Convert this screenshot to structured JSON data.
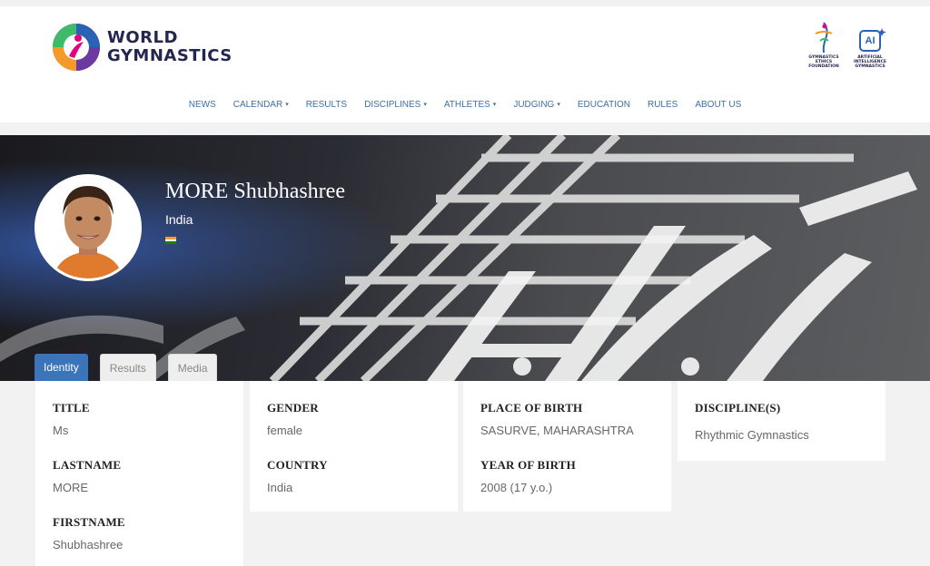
{
  "header": {
    "logo_line1": "WORLD",
    "logo_line2": "GYMNASTICS",
    "partners": [
      {
        "label": "GYMNASTICS\nETHICS\nFOUNDATION",
        "icon": "ethics-foundation-logo"
      },
      {
        "badge": "AI",
        "label": "ARTIFICIAL\nINTELLIGENCE\nGYMNASTICS",
        "icon": "ai-gymnastics-logo"
      }
    ]
  },
  "nav": {
    "items": [
      {
        "label": "NEWS",
        "has_caret": false
      },
      {
        "label": "CALENDAR",
        "has_caret": true
      },
      {
        "label": "RESULTS",
        "has_caret": false
      },
      {
        "label": "DISCIPLINES",
        "has_caret": true
      },
      {
        "label": "ATHLETES",
        "has_caret": true
      },
      {
        "label": "JUDGING",
        "has_caret": true
      },
      {
        "label": "EDUCATION",
        "has_caret": false
      },
      {
        "label": "RULES",
        "has_caret": false
      },
      {
        "label": "ABOUT US",
        "has_caret": false
      }
    ],
    "caret": "▾"
  },
  "athlete": {
    "name": "MORE Shubhashree",
    "country": "India",
    "flag_colors": [
      "#ff9933",
      "#ffffff",
      "#138808"
    ]
  },
  "tabs": [
    {
      "label": "Identity",
      "active": true
    },
    {
      "label": "Results",
      "active": false
    },
    {
      "label": "Media",
      "active": false
    }
  ],
  "identity": {
    "title_label": "TITLE",
    "title_value": "Ms",
    "lastname_label": "LASTNAME",
    "lastname_value": "MORE",
    "firstname_label": "FIRSTNAME",
    "firstname_value": "Shubhashree",
    "gender_label": "GENDER",
    "gender_value": "female",
    "country_label": "COUNTRY",
    "country_value": "India",
    "birthplace_label": "PLACE OF BIRTH",
    "birthplace_value": "SASURVE, MAHARASHTRA",
    "birthyear_label": "YEAR OF BIRTH",
    "birthyear_value": "2008 (17 y.o.)",
    "discipline_label": "DISCIPLINE(S)",
    "discipline_value": "Rhythmic Gymnastics"
  },
  "colors": {
    "nav_link": "#3d6fa5",
    "tab_active": "#3b74b8",
    "brand_navy": "#23264f"
  }
}
